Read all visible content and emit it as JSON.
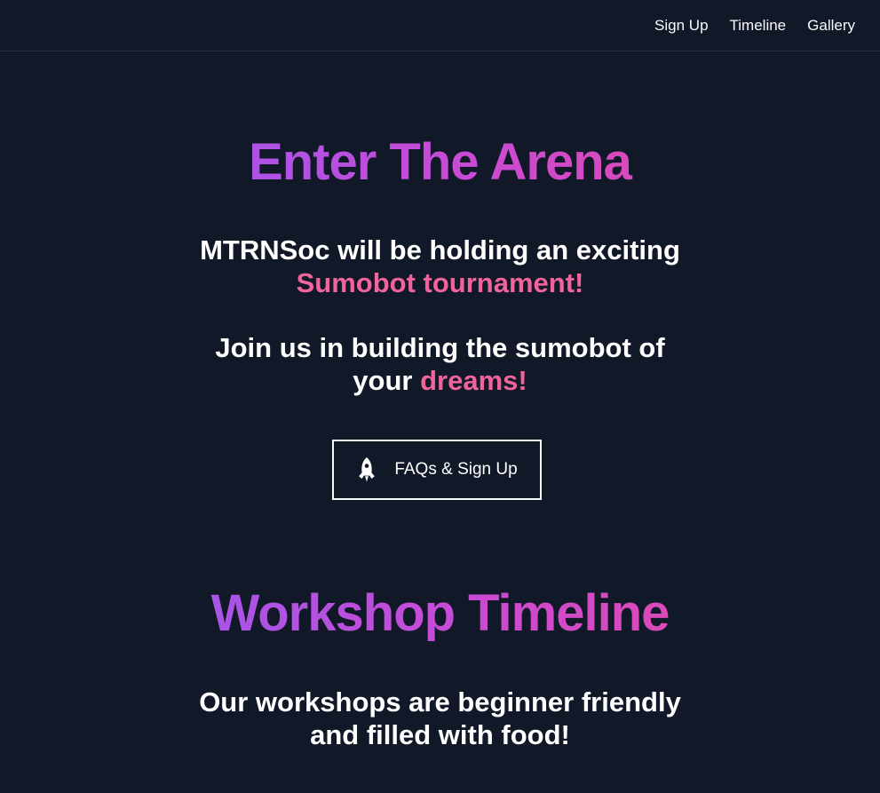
{
  "nav": {
    "items": [
      {
        "label": "Sign Up"
      },
      {
        "label": "Timeline"
      },
      {
        "label": "Gallery"
      }
    ]
  },
  "hero": {
    "title": "Enter The Arena",
    "intro_prefix": "MTRNSoc will be holding an exciting",
    "intro_accent": "Sumobot tournament!",
    "join_prefix": "Join us in building the sumobot of",
    "join_middle": "your",
    "join_accent": "dreams!",
    "button": {
      "label": "FAQs & Sign Up",
      "icon": "rocket-icon"
    }
  },
  "workshop": {
    "title": "Workshop Timeline",
    "description_line_1": "Our workshops are beginner friendly",
    "description_line_2": "and filled with food!"
  },
  "colors": {
    "background": "#111827",
    "accent": "#f0649b",
    "gradient_start": "#8b5cf6",
    "gradient_end": "#ec4899"
  }
}
